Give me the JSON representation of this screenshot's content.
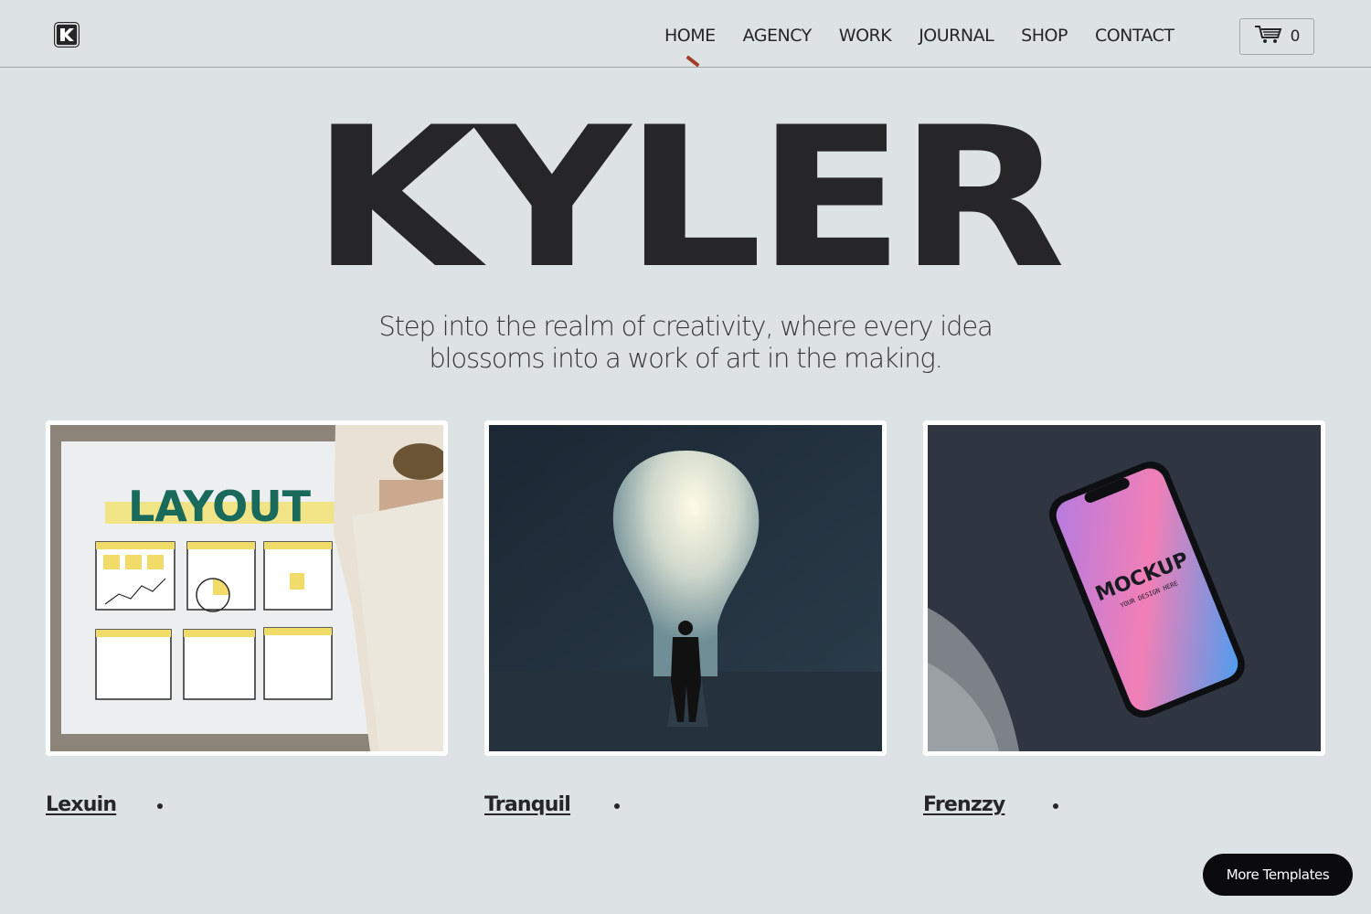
{
  "header": {
    "logo_icon": "k-logo-icon",
    "nav": [
      {
        "label": "HOME"
      },
      {
        "label": "AGENCY"
      },
      {
        "label": "WORK"
      },
      {
        "label": "JOURNAL"
      },
      {
        "label": "SHOP"
      },
      {
        "label": "CONTACT"
      }
    ],
    "active_nav": "HOME",
    "cart": {
      "icon": "cart-icon",
      "count": "0"
    }
  },
  "hero": {
    "title": "KYLER",
    "tagline_line1": "Step into the realm of creativity, where every idea",
    "tagline_line2": "blossoms into a work of art in the making."
  },
  "cards": [
    {
      "title": "Lexuin",
      "image": "layout-wireframe-board-photo",
      "image_text": "LAYOUT"
    },
    {
      "title": "Tranquil",
      "image": "lightbulb-doorway-silhouette-photo"
    },
    {
      "title": "Frenzzy",
      "image": "phone-mockup-on-fabric-photo",
      "image_text": "MOCKUP",
      "image_subtext": "YOUR DESIGN HERE"
    }
  ],
  "more_templates": {
    "label": "More Templates"
  },
  "colors": {
    "background": "#dde2e5",
    "text": "#262628",
    "accent_indicator": "#a33c25",
    "button_bg": "#0b0b0d"
  }
}
